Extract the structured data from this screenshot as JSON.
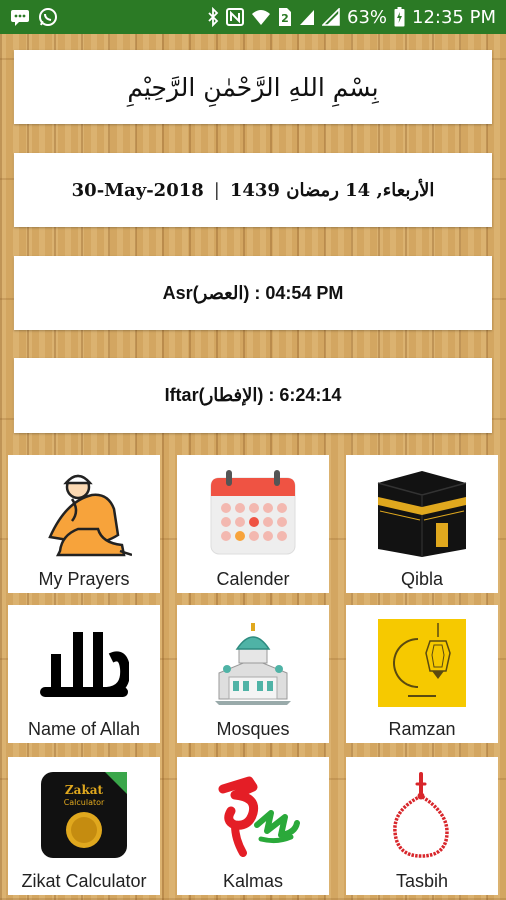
{
  "status_bar": {
    "battery_percent": "63%",
    "time": "12:35 PM",
    "left_icons": [
      "message-icon",
      "whatsapp-icon"
    ],
    "right_icons": [
      "bluetooth-icon",
      "nfc-icon",
      "wifi-icon",
      "sim-2-icon",
      "signal-icon",
      "signal-icon",
      "battery-icon"
    ]
  },
  "bismillah": "بِسْمِ اللهِ الرَّحْمٰنِ الرَّحِيْمِ",
  "date": {
    "gregorian": "30-May-2018",
    "separator": "|",
    "hijri": "الأربعاء, 14 رمضان 1439"
  },
  "prayer": {
    "text": "Asr(العصر) : 04:54 PM"
  },
  "iftar": {
    "text": "Iftar(الإفطار) : 6:24:14"
  },
  "tiles": [
    {
      "label": "My Prayers",
      "icon": "praying-man-icon"
    },
    {
      "label": "Calender",
      "icon": "calendar-icon"
    },
    {
      "label": "Qibla",
      "icon": "kaaba-icon"
    },
    {
      "label": "Name of Allah",
      "icon": "allah-calligraphy-icon"
    },
    {
      "label": "Mosques",
      "icon": "mosque-icon"
    },
    {
      "label": "Ramzan",
      "icon": "ramzan-lantern-icon"
    },
    {
      "label": "Zikat Calculator",
      "icon": "zakat-calculator-icon"
    },
    {
      "label": "Kalmas",
      "icon": "kalma-calligraphy-icon"
    },
    {
      "label": "Tasbih",
      "icon": "tasbih-beads-icon"
    }
  ],
  "zakat_icon_text": [
    "Zakat",
    "Calculator"
  ],
  "colors": {
    "status_bar": "#2b7a25",
    "card": "#ffffff",
    "wood": "#d3a661",
    "calendar_header": "#ef5343",
    "kaaba_gold": "#e0a81e",
    "mosque_dome": "#4fb3a6",
    "ramzan_bg": "#f6c900",
    "kalma_red": "#e41e26",
    "kalma_green": "#2aa93a",
    "tasbih_red": "#d8262b"
  }
}
